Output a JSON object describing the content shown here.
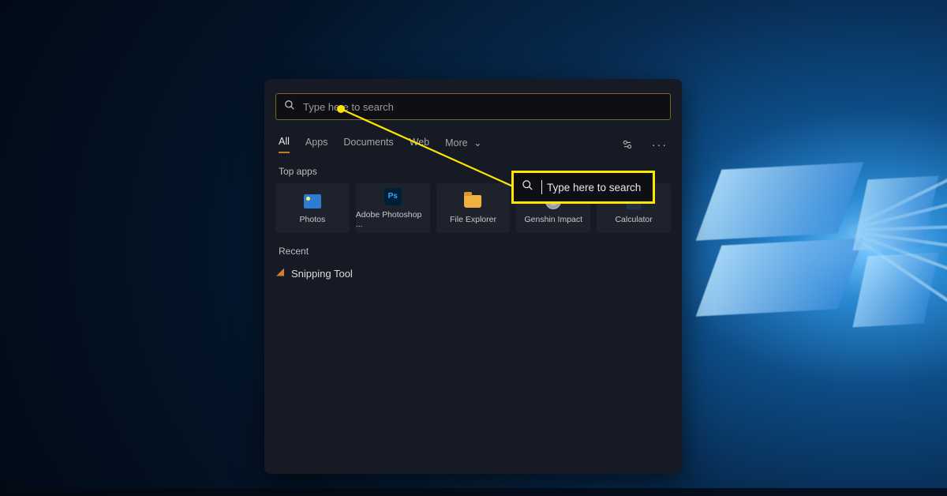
{
  "search": {
    "placeholder": "Type here to search"
  },
  "tabs": {
    "all": "All",
    "apps": "Apps",
    "documents": "Documents",
    "web": "Web",
    "more": "More"
  },
  "sections": {
    "top_apps": "Top apps",
    "recent": "Recent"
  },
  "top_apps": [
    {
      "label": "Photos"
    },
    {
      "label": "Adobe Photoshop ..."
    },
    {
      "label": "File Explorer"
    },
    {
      "label": "Genshin Impact"
    },
    {
      "label": "Calculator"
    }
  ],
  "recent": [
    {
      "label": "Snipping Tool"
    }
  ],
  "callout": {
    "text": "Type here to search"
  },
  "annotation_color": "#ffe600"
}
